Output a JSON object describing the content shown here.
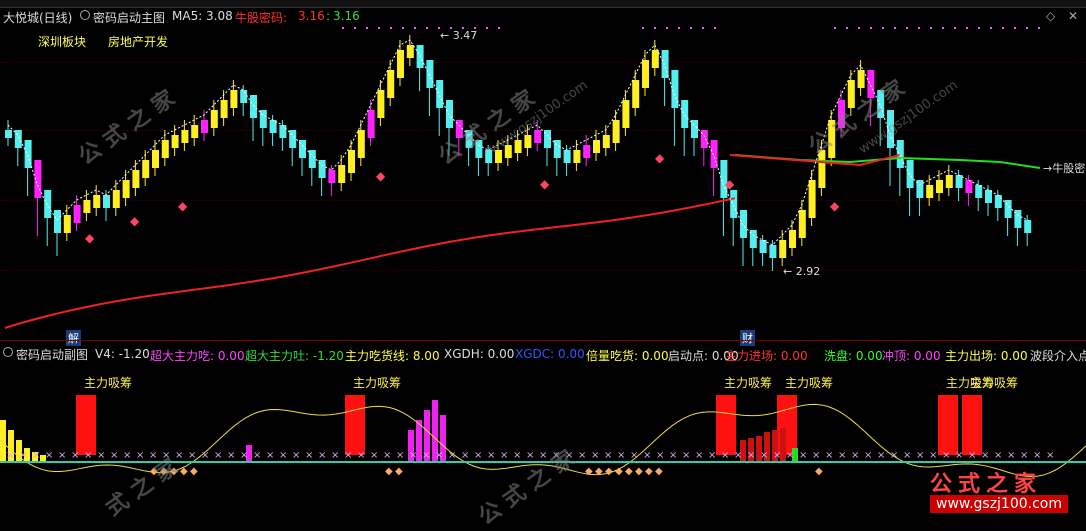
{
  "main_panel": {
    "stock_name": "大悦城(日线)",
    "indicator_name": "密码启动主图",
    "ma5_label": "MA5:",
    "ma5_value": "3.08",
    "secret_label": "牛股密码:",
    "secret_value1": "3.16",
    "secret_value2": "3.16",
    "sector1": "深圳板块",
    "sector2": "房地产开发",
    "high_label": "3.47",
    "low_label": "2.92",
    "right_label": "牛股密",
    "mark_jie": "解",
    "mark_cai": "财"
  },
  "sub_panel": {
    "indicator_name": "密码启动副图",
    "items": [
      {
        "label": "V4:",
        "value": "-1.20",
        "color": "#dddddd"
      },
      {
        "label": "超大主力吃:",
        "value": "0.00",
        "color": "#ff44ff"
      },
      {
        "label": "超大主力吐:",
        "value": "-1.20",
        "color": "#33dd33"
      },
      {
        "label": "主力吃货线:",
        "value": "8.00",
        "color": "#ffff44"
      },
      {
        "label": "XGDH:",
        "value": "0.00",
        "color": "#dddddd"
      },
      {
        "label": "XGDC:",
        "value": "0.00",
        "color": "#3355ff"
      },
      {
        "label": "倍量吃货:",
        "value": "0.00",
        "color": "#ffff44"
      },
      {
        "label": "启动点:",
        "value": "0.00",
        "color": "#dddddd"
      },
      {
        "label": "主力进场:",
        "value": "0.00",
        "color": "#ff3333"
      },
      {
        "label": "洗盘:",
        "value": "0.00",
        "color": "#33ff33"
      },
      {
        "label": "冲顶:",
        "value": "0.00",
        "color": "#ff44ff"
      },
      {
        "label": "主力出场:",
        "value": "0.00",
        "color": "#ffff44"
      },
      {
        "label": "波段介入点",
        "value": "",
        "color": "#dddddd"
      }
    ],
    "absorb_label": "主力吸筹"
  },
  "watermark": {
    "text": "公式之家",
    "url": "www.gszj100.com"
  },
  "colors": {
    "up": "#ffee22",
    "down": "#55eeee",
    "strong": "#ff22ff",
    "ma_red": "#ee2222",
    "ma_green": "#22dd22"
  }
}
